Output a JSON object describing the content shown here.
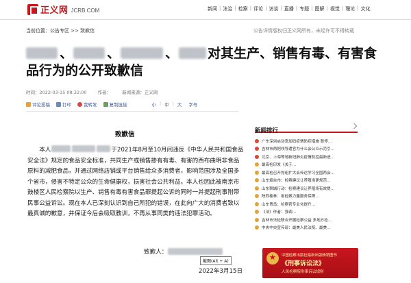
{
  "site": {
    "logo_cn": "正义网",
    "logo_en": "JCRB.COM",
    "nav": [
      "新闻",
      "法治",
      "检察",
      "评论",
      "访谈",
      "直播",
      "专题",
      "图解",
      "视觉",
      "理论",
      "文化"
    ]
  },
  "breadcrumb": {
    "prefix": "当前位置：",
    "path": "公告专区 >> 致歉信"
  },
  "copyright_note": "公告详情版权归正义网所有，未经许可不得转载",
  "article": {
    "title_line1_suffix": "对其生产、销售有毒、有害食",
    "title_line2": "品行为的公开致歉信",
    "title_sep": "、",
    "meta": {
      "time": "时间：2022-03-15 08:32:00",
      "author": "作者：",
      "source": "新闻来源：正义网"
    },
    "tools": {
      "comment": "评论投稿",
      "print": "打印",
      "repost": "我转发",
      "copy": "复制链接",
      "font_small": "小",
      "font_medium": "中",
      "font_large": "大",
      "font_label": "字号"
    }
  },
  "letter": {
    "title": "致歉信",
    "p1_a": "本人",
    "p1_b": "于2021年8月至10月间违反《中华人民共和国食品安全法》规定的食品安全标准，共同生产或销售掺有有毒、有害的西布曲明非食品原料的减肥食品，并通过网络店铺或平台销售给众多消费者，影响范围涉及全国多个省市，侵害不特定公众的生命健康权，损害社会公共利益。本人也因此被南京市鼓楼区人民检察院以生产、销售有毒有害食品罪提起公诉的同时一并提起刑事附带民事公益诉讼。现在本人已深刻认识到自己所犯的错误，在此向广大的消费者致以最真诚的歉意，并保证今后会吸取教训，不再从事同类的违法犯罪活动。",
    "signer_label": "致歉人：",
    "date": "2022年3月15日"
  },
  "tooltip": "截图(Alt + A)",
  "sidebar": {
    "title": "新闻排行",
    "items": [
      "广东深圳启动宽加码疫情防控措施 暂停…",
      "吉林市两把领导遭官为什么会公众示范引…",
      "北京、上海等地新冠肺炎疫情防控最新进…",
      "最高检印发《关于…",
      "最高检召开党组扩大会传达学习全国两会…",
      "山东烟台市：检察建议让养殖场更规范…",
      "山东聊城行动：检察建议让养殖场有效提…",
      "陕西榆林：用检察力量服务保障…",
      "山东青岛：检察官专业化提升…",
      "《法》作者：强调…",
      "吉林市法检联合开展检察公益 多地方检…",
      "中央中央宣传部：最美人民法院、最美…"
    ]
  },
  "banner": {
    "line1": "中国检察出版社最新出版畅销图书",
    "line2": "《刑事诉讼法》",
    "line3": "人民检察院刑事诉讼规则"
  }
}
